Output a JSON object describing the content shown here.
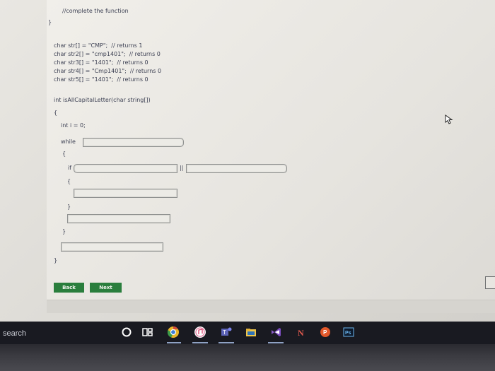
{
  "code": {
    "comment_line": "//complete the function",
    "close_brace_top": "}",
    "decl_1": "char str[] = \"CMP\";  // returns 1",
    "decl_2": "char str2[] = \"cmp1401\";  // returns 0",
    "decl_3": "char str3[] = \"1401\";  // returns 0",
    "decl_4": "char str4[] = \"Cmp1401\";  // returns 0",
    "decl_5": "char str5[] = \"1401\";  // returns 0",
    "signature": "int isAllCapitalLetter(char string[])",
    "open_brace_fn": "{",
    "int_decl": "int i = 0;",
    "while_kw": "while",
    "open_brace_while": "{",
    "if_kw": "if",
    "or_op": "||",
    "open_brace_if": "{",
    "close_brace_if": "}",
    "close_brace_while": "}",
    "close_brace_fn": "}"
  },
  "fields": {
    "while_condition": "",
    "if_condition_left": "",
    "if_condition_right": "",
    "if_body": "",
    "after_if": "",
    "return_stmt": ""
  },
  "buttons": {
    "back": "Back",
    "next": "Next"
  },
  "taskbar": {
    "search_label": "search",
    "apps": [
      "cortana-icon",
      "task-view-icon",
      "chrome-icon",
      "itunes-icon",
      "teams-icon",
      "file-explorer-icon",
      "visual-studio-icon",
      "onenote-icon",
      "powerpoint-icon",
      "photoshop-icon"
    ]
  },
  "colors": {
    "button_green": "#2a7e3d",
    "taskbar": "#191a21",
    "text": "#3b3f52"
  }
}
